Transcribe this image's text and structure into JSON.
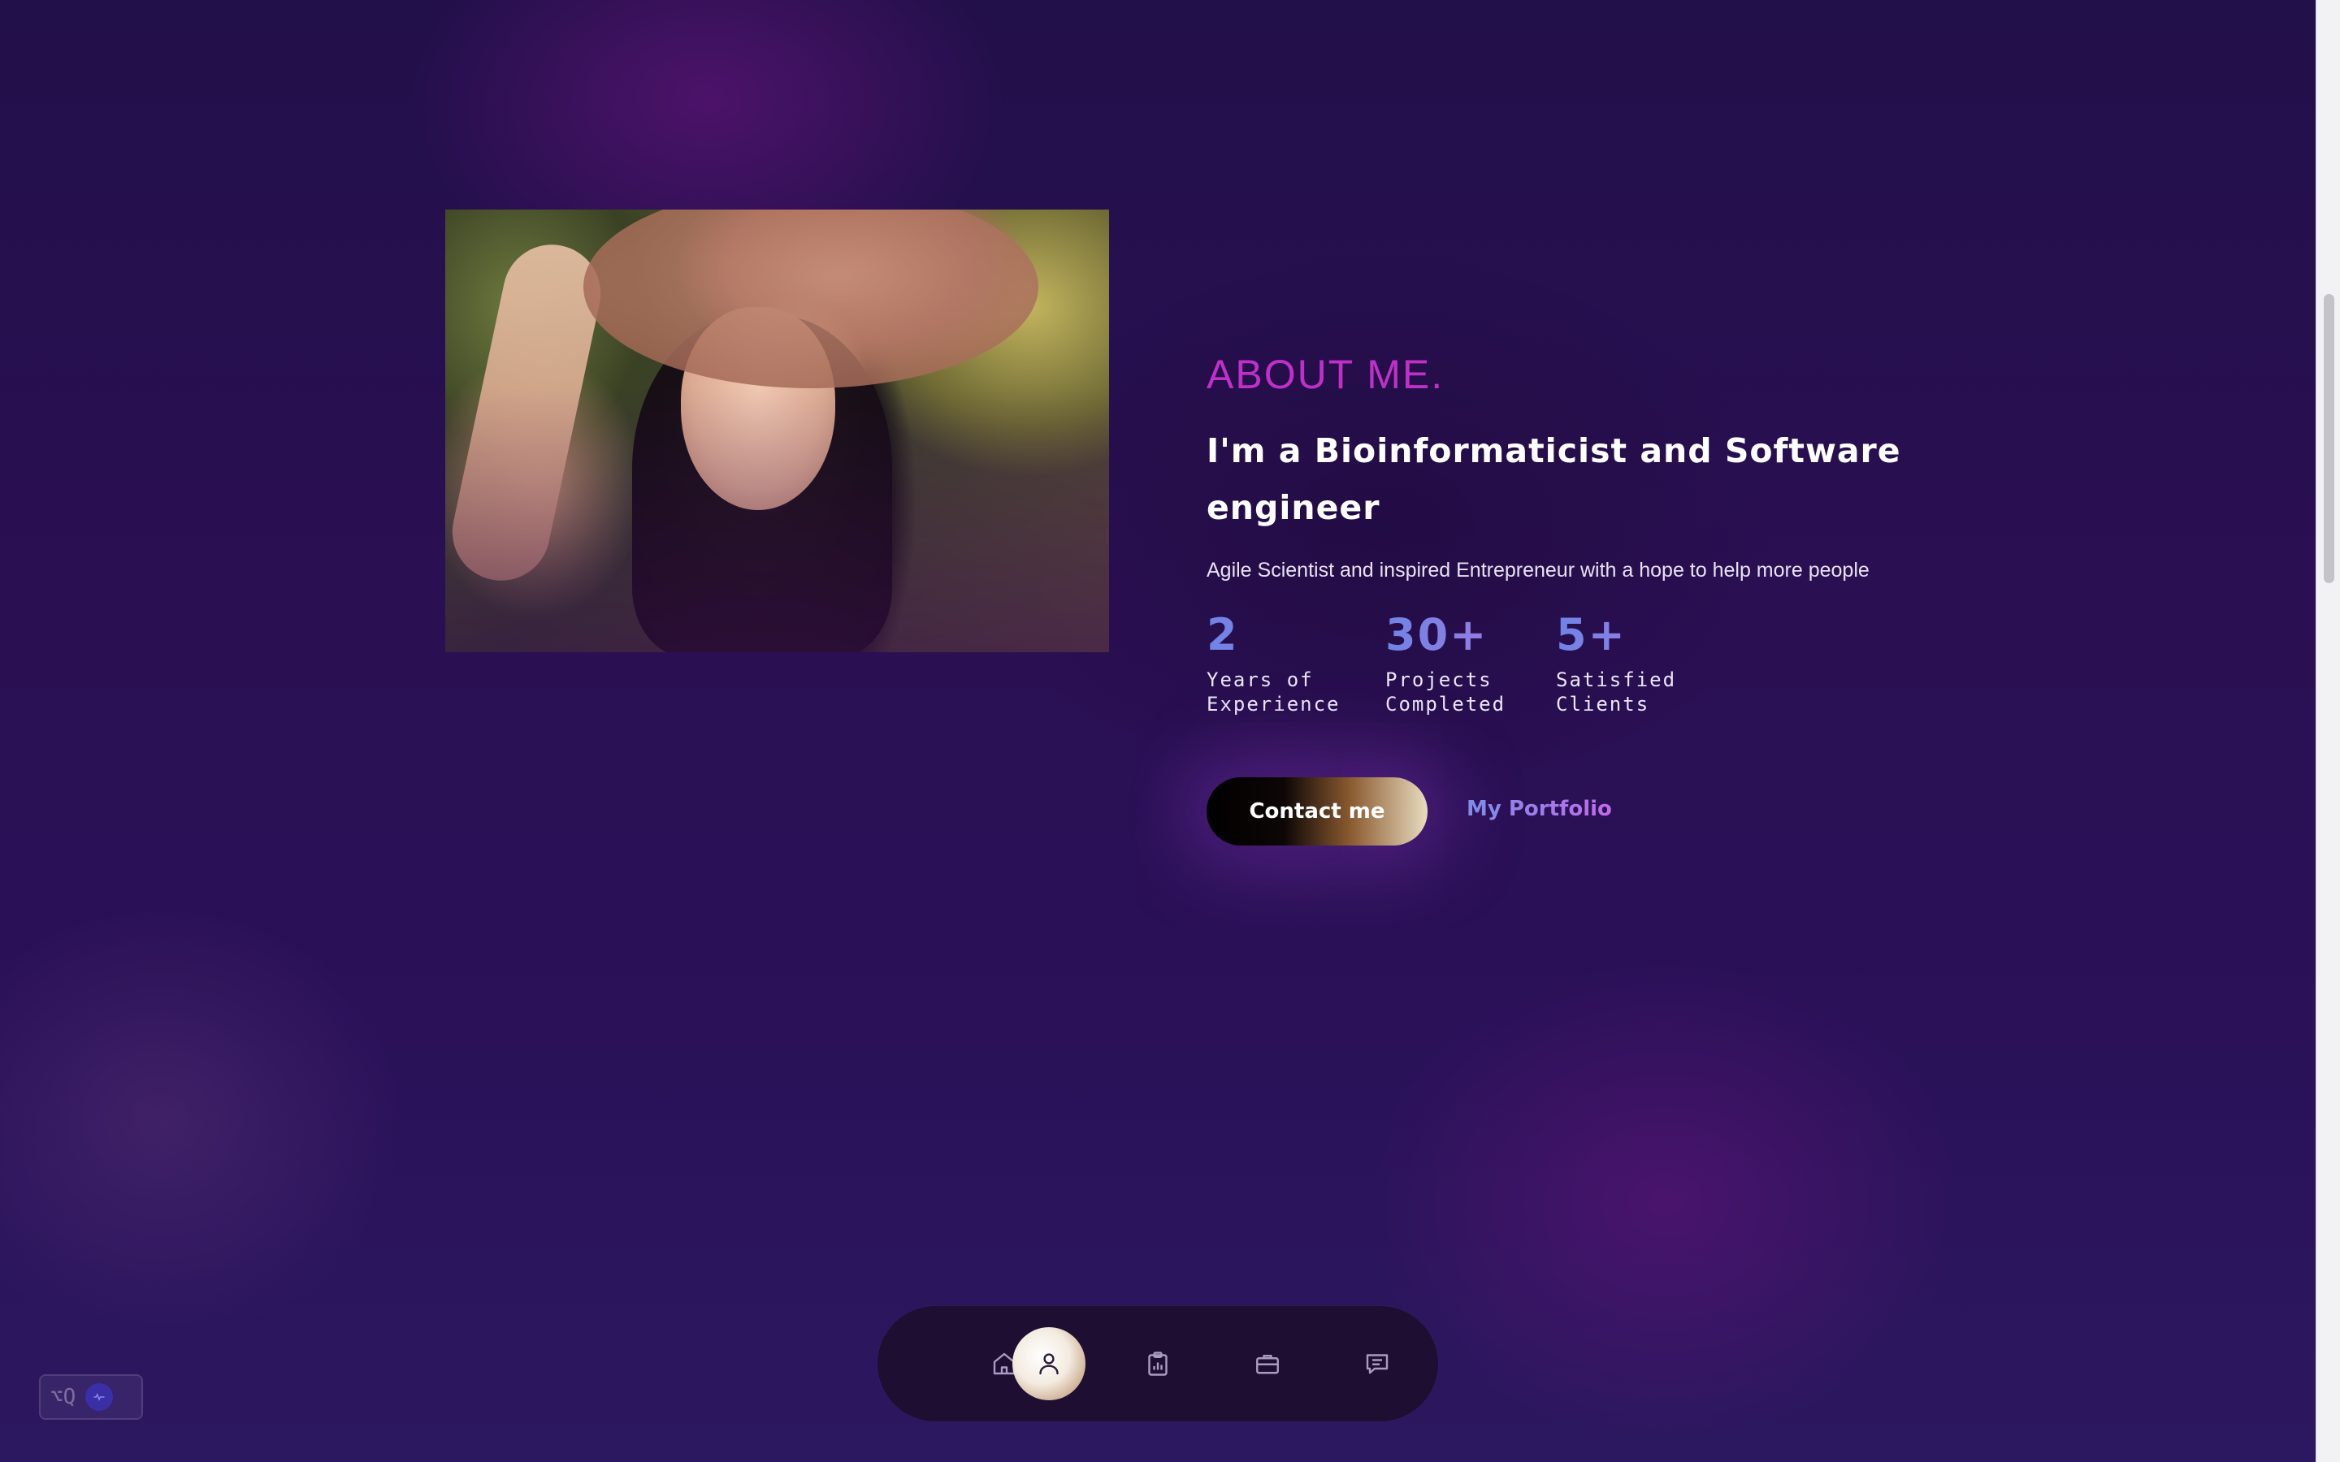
{
  "about": {
    "title": "ABOUT ME.",
    "headline": "I'm a Bioinformaticist and Software engineer",
    "subline": "Agile Scientist and inspired Entrepreneur with a hope to help more people",
    "stats": [
      {
        "value": "2",
        "label": "Years of\nExperience"
      },
      {
        "value": "30+",
        "label": "Projects\nCompleted"
      },
      {
        "value": "5+",
        "label": "Satisfied\nClients"
      }
    ],
    "contact_label": "Contact me",
    "portfolio_label": "My Portfolio"
  },
  "portrait": {
    "icon": "portrait-photo"
  },
  "nav": {
    "active": "about",
    "items": [
      {
        "icon": "home-icon"
      },
      {
        "icon": "user-icon"
      },
      {
        "icon": "clipboard-chart-icon"
      },
      {
        "icon": "briefcase-icon"
      },
      {
        "icon": "message-icon"
      }
    ]
  },
  "widget": {
    "label": "⌥Q"
  },
  "colors": {
    "accent": "#c030c8",
    "stat": "#7e7ee0",
    "background": "#2a0f52"
  }
}
